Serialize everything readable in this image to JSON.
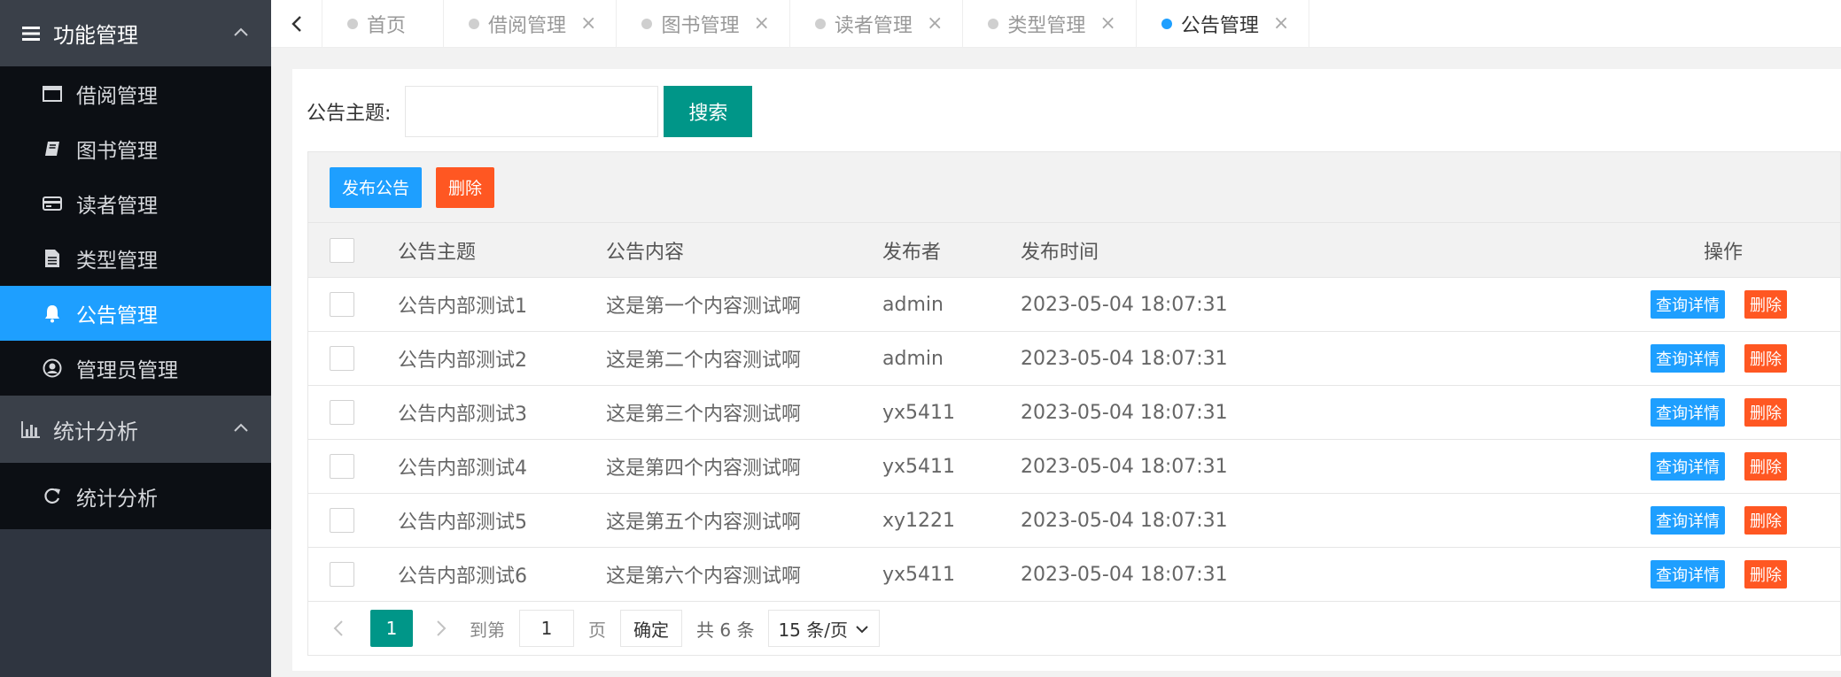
{
  "sidebar": {
    "groups": [
      {
        "title": "功能管理",
        "icon": "menu-lines-icon",
        "items": [
          {
            "label": "借阅管理",
            "icon": "window-icon"
          },
          {
            "label": "图书管理",
            "icon": "book-icon"
          },
          {
            "label": "读者管理",
            "icon": "card-icon"
          },
          {
            "label": "类型管理",
            "icon": "file-icon"
          },
          {
            "label": "公告管理",
            "icon": "bell-icon",
            "active": true
          },
          {
            "label": "管理员管理",
            "icon": "user-circle-icon"
          }
        ]
      },
      {
        "title": "统计分析",
        "icon": "bar-chart-icon",
        "items": [
          {
            "label": "统计分析",
            "icon": "refresh-icon"
          }
        ]
      }
    ]
  },
  "tabs": [
    {
      "label": "首页",
      "closable": false
    },
    {
      "label": "借阅管理",
      "closable": true
    },
    {
      "label": "图书管理",
      "closable": true
    },
    {
      "label": "读者管理",
      "closable": true
    },
    {
      "label": "类型管理",
      "closable": true
    },
    {
      "label": "公告管理",
      "closable": true,
      "active": true
    }
  ],
  "tab_close_glyph": "×",
  "search": {
    "label": "公告主题:",
    "value": "",
    "button": "搜索"
  },
  "toolbar": {
    "publish": "发布公告",
    "delete": "删除"
  },
  "table": {
    "columns": [
      "公告主题",
      "公告内容",
      "发布者",
      "发布时间",
      "操作"
    ],
    "rows": [
      {
        "title": "公告内部测试1",
        "content": "这是第一个内容测试啊",
        "author": "admin",
        "time": "2023-05-04 18:07:31"
      },
      {
        "title": "公告内部测试2",
        "content": "这是第二个内容测试啊",
        "author": "admin",
        "time": "2023-05-04 18:07:31"
      },
      {
        "title": "公告内部测试3",
        "content": "这是第三个内容测试啊",
        "author": "yx5411",
        "time": "2023-05-04 18:07:31"
      },
      {
        "title": "公告内部测试4",
        "content": "这是第四个内容测试啊",
        "author": "yx5411",
        "time": "2023-05-04 18:07:31"
      },
      {
        "title": "公告内部测试5",
        "content": "这是第五个内容测试啊",
        "author": "xy1221",
        "time": "2023-05-04 18:07:31"
      },
      {
        "title": "公告内部测试6",
        "content": "这是第六个内容测试啊",
        "author": "yx5411",
        "time": "2023-05-04 18:07:31"
      }
    ],
    "row_actions": {
      "detail": "查询详情",
      "delete": "删除"
    }
  },
  "pager": {
    "current": "1",
    "goto_label": "到第",
    "goto_value": "1",
    "page_unit": "页",
    "confirm": "确定",
    "total": "共 6 条",
    "page_size": "15 条/页"
  },
  "colors": {
    "sidebar_bg": "#2f3540",
    "submenu_bg": "#0c0f14",
    "active_blue": "#1e9fff",
    "primary_green": "#009688",
    "danger_orange": "#ff5722"
  }
}
